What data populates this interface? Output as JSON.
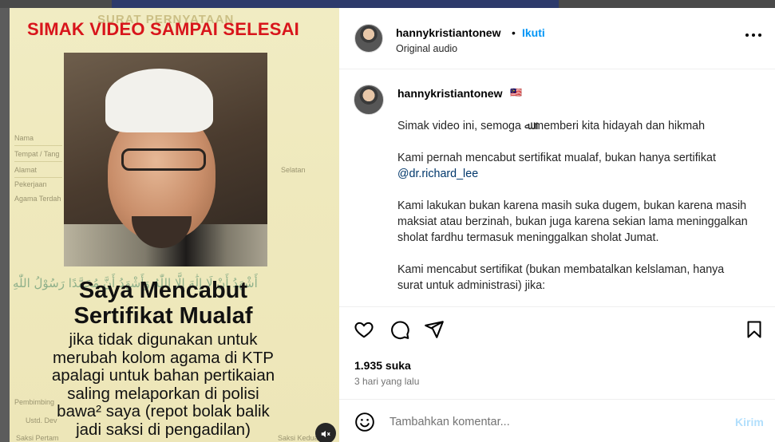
{
  "video": {
    "headline": "SIMAK VIDEO SAMPAI SELESAI",
    "caption_title_line1": "Saya Mencabut",
    "caption_title_line2": "Sertifikat Mualaf",
    "caption_lines": [
      "jika tidak digunakan untuk",
      "merubah kolom agama di KTP",
      "apalagi untuk bahan pertikaian",
      "saling melaporkan di polisi",
      "bawa² saya (repot bolak balik",
      "jadi saksi di pengadilan)"
    ],
    "background_doc": {
      "title": "SURAT PERNYATAAN",
      "fields": [
        "Nama",
        "Tempat / Tang",
        "Alamat",
        "Pekerjaan",
        "Agama Terdah",
        "Pembimbing",
        "Ustd. Dev",
        "Saksi Pertam"
      ],
      "right_fields": [
        "Selatan",
        "Saksi Kedua"
      ],
      "arabic": "أَشْهَدُ أَنْ لَا إِلَٰهَ إِلَّا اللّٰهُ وَأَشْهَدُ أَنَّ مُحَمَّدًا رَسُوْلُ اللّٰهِ"
    },
    "mute_icon": "speaker-muted-icon"
  },
  "post": {
    "username": "hannykristiantonew",
    "follow_label": "Ikuti",
    "separator": "•",
    "audio_label": "Original audio",
    "caption_user": "hannykristiantonew",
    "caption_user_badge": "🇲🇾",
    "caption_paragraphs": [
      "Simak video ini, semoga ﷲ memberi kita hidayah dan hikmah",
      "Kami pernah mencabut sertifikat mualaf, bukan hanya sertifikat",
      "Kami lakukan bukan karena masih suka dugem, bukan karena masih maksiat atau berzinah, bukan juga karena sekian lama meninggalkan sholat fardhu termasuk meninggalkan sholat Jumat.",
      "Kami mencabut sertifikat (bukan membatalkan kelslaman, hanya surat untuk administrasi) jika:"
    ],
    "mention": "@dr.richard_lee",
    "likes": "1.935 suka",
    "time_ago": "3 hari yang lalu",
    "comment_placeholder": "Tambahkan komentar...",
    "post_button": "Kirim"
  },
  "colors": {
    "follow_blue": "#0095f6",
    "post_button_disabled": "#b2dffc",
    "headline_red": "#d8151b",
    "mention": "#00376b"
  }
}
